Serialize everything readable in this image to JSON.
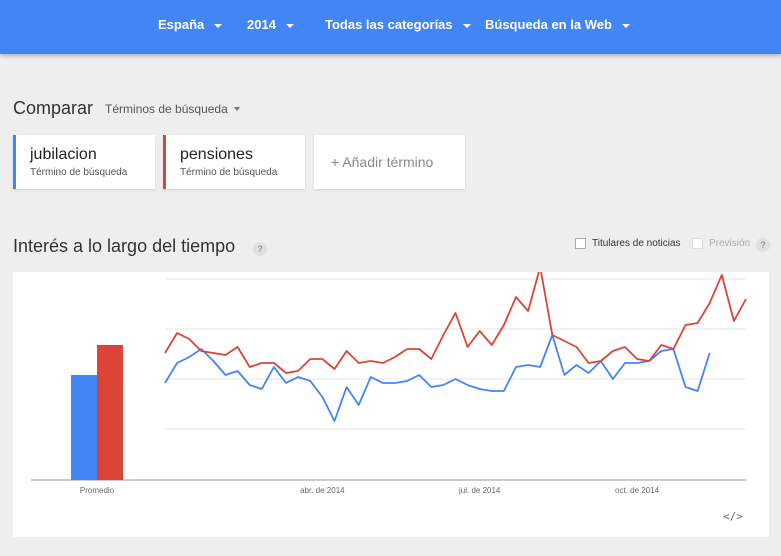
{
  "header": {
    "filters": [
      {
        "label": "España"
      },
      {
        "label": "2014"
      },
      {
        "label": "Todas las categorías"
      },
      {
        "label": "Búsqueda en la Web"
      }
    ],
    "bg_color": "#4285f4"
  },
  "compare": {
    "title": "Comparar",
    "dropdown_label": "Términos de búsqueda"
  },
  "terms": [
    {
      "name": "jubilacion",
      "type": "Término de búsqueda",
      "color": "#4285f4"
    },
    {
      "name": "pensiones",
      "type": "Término de búsqueda",
      "color": "#db4437"
    }
  ],
  "add_term_label": "+ Añadir término",
  "interest": {
    "title": "Interés a lo largo del tiempo",
    "help_icon": "?",
    "options": [
      {
        "label": "Titulares de noticias",
        "checked": false
      },
      {
        "label": "Previsión",
        "checked": false,
        "disabled": true
      }
    ],
    "embed_icon": "</>"
  },
  "chart_data": {
    "type": "line",
    "average_label": "Promedio",
    "averages": [
      {
        "name": "jubilacion",
        "value": 52,
        "color": "#4285f4"
      },
      {
        "name": "pensiones",
        "value": 67,
        "color": "#db4437"
      }
    ],
    "x_tick_labels": [
      {
        "label": "abr. de 2014",
        "index": 13
      },
      {
        "label": "jul. de 2014",
        "index": 26
      },
      {
        "label": "oct. de 2014",
        "index": 39
      }
    ],
    "ylim": [
      0,
      100
    ],
    "grid": true,
    "series": [
      {
        "name": "jubilacion",
        "color": "#4285f4",
        "values": [
          48,
          58,
          61,
          65,
          59,
          52,
          54,
          47,
          45,
          56,
          48,
          51,
          49,
          41,
          29,
          46,
          37,
          51,
          48,
          48,
          49,
          52,
          46,
          47,
          50,
          47,
          45,
          44,
          44,
          56,
          57,
          56,
          72,
          52,
          57,
          53,
          59,
          50,
          58,
          58,
          59,
          64,
          65,
          46,
          44,
          63
        ]
      },
      {
        "name": "pensiones",
        "color": "#db4437",
        "values": [
          63,
          73,
          70,
          64,
          63,
          62,
          66,
          56,
          58,
          58,
          53,
          54,
          60,
          60,
          55,
          64,
          58,
          59,
          58,
          61,
          65,
          65,
          60,
          72,
          83,
          66,
          74,
          67,
          77,
          91,
          84,
          106,
          72,
          69,
          66,
          58,
          59,
          64,
          66,
          60,
          59,
          67,
          65,
          77,
          78,
          88,
          102,
          79,
          90
        ]
      }
    ]
  }
}
